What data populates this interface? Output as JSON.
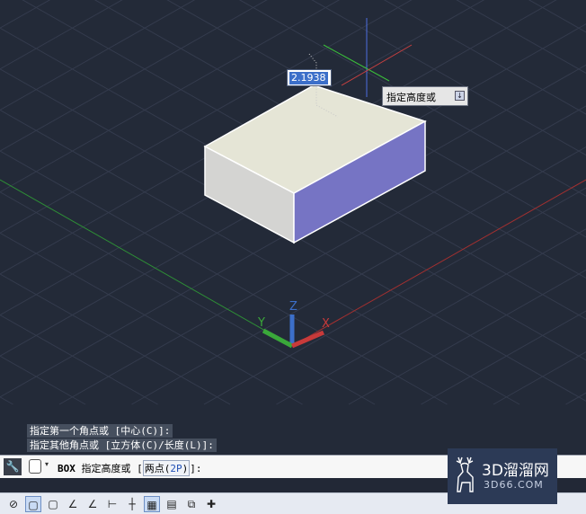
{
  "dynamic_input": {
    "value": "2.1938"
  },
  "tooltip": {
    "text": "指定高度或",
    "arrow": "↓"
  },
  "ucs": {
    "x_label": "X",
    "y_label": "Y",
    "z_label": "Z"
  },
  "command_history": [
    "指定第一个角点或 [中心(C)]:",
    "指定其他角点或 [立方体(C)/长度(L)]:"
  ],
  "command_line": {
    "command": "BOX",
    "prompt": " 指定高度或 [",
    "option_label": "两点(",
    "option_key": "2P",
    "option_close": ")",
    "suffix": "]:"
  },
  "watermark": {
    "brand": "3D溜溜网",
    "url": "3D66.COM"
  },
  "statusbar": {
    "buttons": [
      {
        "name": "coordinate-icon",
        "glyph": "⊘",
        "on": false
      },
      {
        "name": "snap-icon",
        "glyph": "▢",
        "on": true
      },
      {
        "name": "box-icon",
        "glyph": "▢",
        "on": false
      },
      {
        "name": "ortho-angle-icon",
        "glyph": "∠",
        "on": false
      },
      {
        "name": "polar-icon",
        "glyph": "∠",
        "on": false
      },
      {
        "name": "otrack-icon",
        "glyph": "⊢",
        "on": false
      },
      {
        "name": "crosshair-icon",
        "glyph": "┼",
        "on": false
      },
      {
        "name": "grid-icon",
        "glyph": "▦",
        "on": true
      },
      {
        "name": "properties-icon",
        "glyph": "▤",
        "on": false
      },
      {
        "name": "selection-icon",
        "glyph": "⧉",
        "on": false
      },
      {
        "name": "annotation-icon",
        "glyph": "✚",
        "on": false
      }
    ]
  },
  "colors": {
    "background": "#232a38",
    "grid": "#3a4154",
    "top_face": "#e5e5d6",
    "left_face": "#d4d4d2",
    "right_face": "#7674c4",
    "x_axis": "#c83a3a",
    "y_axis": "#3aa83a",
    "z_axis": "#3c6fc9"
  }
}
